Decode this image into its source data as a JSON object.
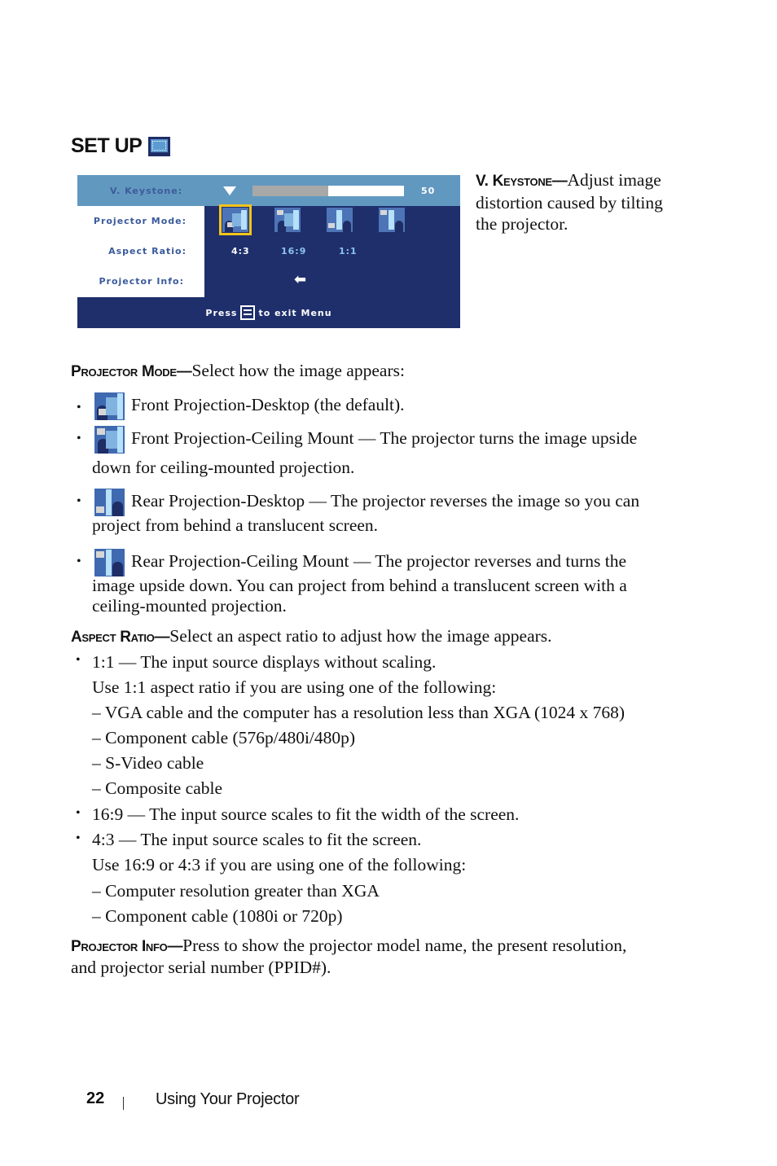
{
  "section_title": "SET UP",
  "section_icon": "setup-screen-icon",
  "osd": {
    "keystone_label": "V. Keystone:",
    "keystone_value": "50",
    "keystone_fraction": 0.5,
    "projector_mode_label": "Projector Mode:",
    "aspect_ratio_label": "Aspect Ratio:",
    "projector_info_label": "Projector Info:",
    "projector_modes": [
      "front-projection-desktop-icon",
      "front-projection-ceiling-icon",
      "rear-projection-desktop-icon",
      "rear-projection-ceiling-icon"
    ],
    "selected_mode_index": 0,
    "aspect_ratios": [
      "4:3",
      "16:9",
      "1:1"
    ],
    "selected_aspect_index": 0,
    "info_icon": "enter-arrow-icon",
    "exit_prefix": "Press",
    "exit_suffix": "to exit Menu",
    "colors": {
      "panel": "#1f2f6c",
      "header": "#6198c0",
      "highlight": "#f2c41a",
      "label": "#3a5a9c",
      "inactive_option": "#8cc4f0"
    }
  },
  "keystone_desc": {
    "term": "V. Keystone—",
    "text": "Adjust image distortion caused by tilting the projector."
  },
  "projector_mode": {
    "term": "Projector Mode—",
    "intro": "Select how the image appears:",
    "items": [
      {
        "icon": "front-projection-desktop-icon",
        "text": "Front Projection-Desktop (the default)."
      },
      {
        "icon": "front-projection-ceiling-icon",
        "text": "Front Projection-Ceiling Mount — The projector turns the image upside",
        "text2": "down for ceiling-mounted projection."
      },
      {
        "icon": "rear-projection-desktop-icon",
        "text": "Rear Projection-Desktop — The projector reverses the image so you can",
        "text2": "project from behind a translucent screen."
      },
      {
        "icon": "rear-projection-ceiling-icon",
        "text": "Rear Projection-Ceiling Mount — The projector reverses and turns the",
        "text2": "image upside down. You can project from behind a translucent screen with a",
        "text3": "ceiling-mounted projection."
      }
    ]
  },
  "aspect_ratio": {
    "term": "Aspect Ratio—",
    "intro": "Select an aspect ratio to adjust how the image appears.",
    "lines": [
      "1:1 — The input source displays without scaling.",
      "Use 1:1 aspect ratio if you are using one of the following:",
      "– VGA cable and the computer has a resolution less than XGA (1024 x 768)",
      "– Component cable (576p/480i/480p)",
      "– S-Video cable",
      "– Composite cable",
      "16:9 — The input source scales to fit the width of the screen.",
      "4:3 — The input source scales to fit the screen.",
      "Use 16:9 or 4:3 if you are using one of the following:",
      "– Computer resolution greater than XGA",
      "– Component cable (1080i or 720p)"
    ],
    "bullet": "•"
  },
  "projector_info": {
    "term": "Projector Info—",
    "text": "Press to show the projector model name, the present resolution,",
    "text2": "and projector serial number (PPID#)."
  },
  "footer": {
    "page_number": "22",
    "chapter": "Using Your Projector"
  }
}
